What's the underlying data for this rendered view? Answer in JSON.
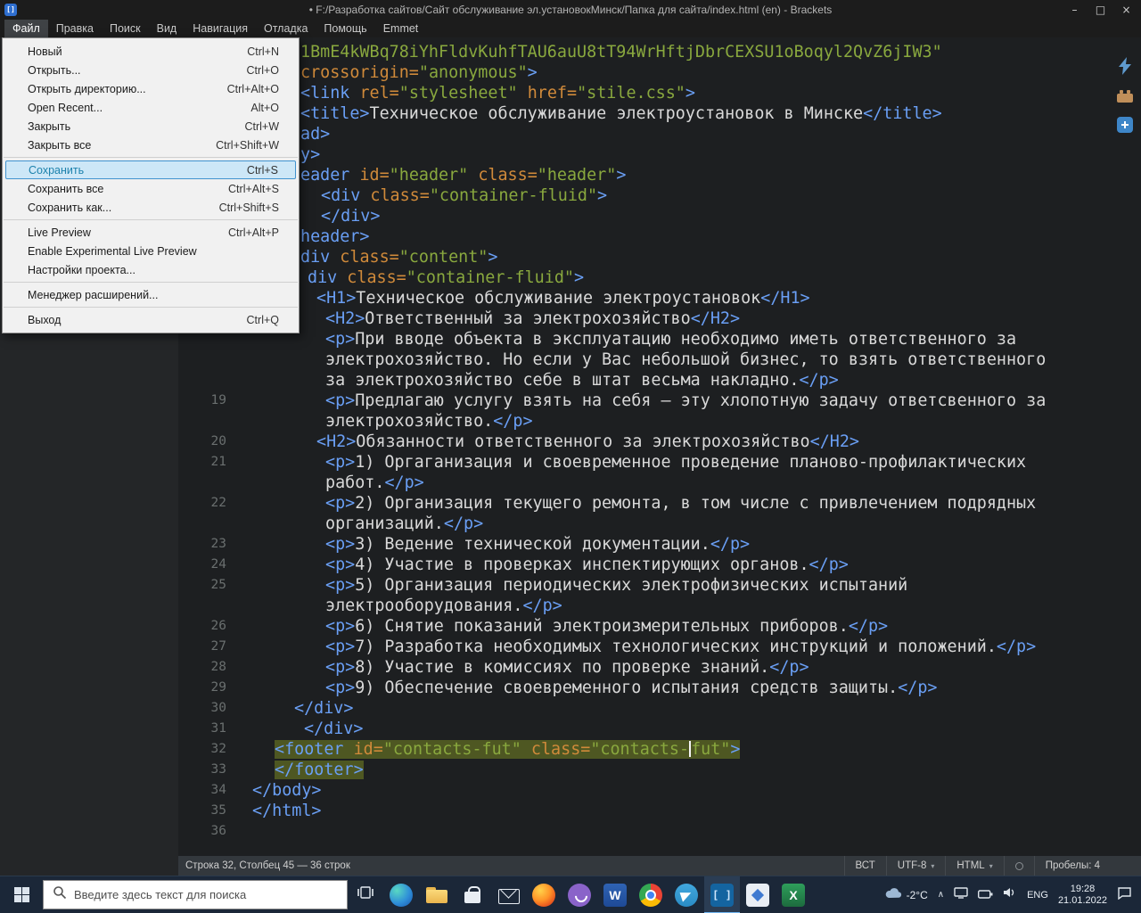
{
  "titlebar": {
    "title": "• F:/Разработка сайтов/Сайт обслуживание эл.установокМинск/Папка для сайта/index.html (en) - Brackets",
    "controls": {
      "minimize": "–",
      "maximize": "□",
      "close": "×"
    }
  },
  "menubar": {
    "active_id": "file",
    "items": [
      {
        "id": "file",
        "label": "Файл"
      },
      {
        "id": "edit",
        "label": "Правка"
      },
      {
        "id": "find",
        "label": "Поиск"
      },
      {
        "id": "view",
        "label": "Вид"
      },
      {
        "id": "navigate",
        "label": "Навигация"
      },
      {
        "id": "debug",
        "label": "Отладка"
      },
      {
        "id": "help",
        "label": "Помощь"
      },
      {
        "id": "emmet",
        "label": "Emmet"
      }
    ]
  },
  "file_menu": {
    "items": [
      {
        "id": "new",
        "label": "Новый",
        "shortcut": "Ctrl+N"
      },
      {
        "id": "open",
        "label": "Открыть...",
        "shortcut": "Ctrl+O"
      },
      {
        "id": "open-folder",
        "label": "Открыть директорию...",
        "shortcut": "Ctrl+Alt+O"
      },
      {
        "id": "open-recent",
        "label": "Open Recent...",
        "shortcut": "Alt+O"
      },
      {
        "id": "close",
        "label": "Закрыть",
        "shortcut": "Ctrl+W"
      },
      {
        "id": "close-all",
        "label": "Закрыть все",
        "shortcut": "Ctrl+Shift+W"
      },
      {
        "separator": true
      },
      {
        "id": "save",
        "label": "Сохранить",
        "shortcut": "Ctrl+S",
        "highlighted": true
      },
      {
        "id": "save-all",
        "label": "Сохранить все",
        "shortcut": "Ctrl+Alt+S"
      },
      {
        "id": "save-as",
        "label": "Сохранить как...",
        "shortcut": "Ctrl+Shift+S"
      },
      {
        "separator": true
      },
      {
        "id": "live-preview",
        "label": "Live Preview",
        "shortcut": "Ctrl+Alt+P"
      },
      {
        "id": "experimental-live-preview",
        "label": "Enable Experimental Live Preview",
        "shortcut": ""
      },
      {
        "id": "project-settings",
        "label": "Настройки проекта...",
        "shortcut": ""
      },
      {
        "separator": true
      },
      {
        "id": "extension-manager",
        "label": "Менеджер расширений...",
        "shortcut": ""
      },
      {
        "separator": true
      },
      {
        "id": "exit",
        "label": "Выход",
        "shortcut": "Ctrl+Q"
      }
    ]
  },
  "editor": {
    "rows": [
      {
        "n": "",
        "ind": 54,
        "segs": [
          [
            "s",
            "1BmE4kWBq78iYhFldvKuhfTAU6auU8tT94WrHftjDbrCEXSU1oBoqyl2QvZ6jIW3\""
          ]
        ]
      },
      {
        "n": "",
        "ind": 54,
        "segs": [
          [
            "a",
            "crossorigin="
          ],
          [
            "s",
            "\"anonymous\""
          ],
          [
            "t",
            ">"
          ]
        ]
      },
      {
        "n": "",
        "ind": 54,
        "segs": [
          [
            "t",
            "<link"
          ],
          [
            "w",
            " "
          ],
          [
            "a",
            "rel="
          ],
          [
            "s",
            "\"stylesheet\""
          ],
          [
            "w",
            " "
          ],
          [
            "a",
            "href="
          ],
          [
            "s",
            "\"stile.css\""
          ],
          [
            "t",
            ">"
          ]
        ]
      },
      {
        "n": "",
        "ind": 54,
        "segs": [
          [
            "t",
            "<title>"
          ],
          [
            "x",
            "Техническое обслуживание электроустановок в Минске"
          ],
          [
            "t",
            "</title>"
          ]
        ]
      },
      {
        "n": "",
        "ind": 54,
        "segs": [
          [
            "t",
            "ad>"
          ]
        ]
      },
      {
        "n": "",
        "ind": 54,
        "segs": [
          [
            "t",
            "y>"
          ]
        ]
      },
      {
        "n": "",
        "ind": 54,
        "segs": [
          [
            "t",
            "eader"
          ],
          [
            "w",
            " "
          ],
          [
            "a",
            "id="
          ],
          [
            "s",
            "\"header\""
          ],
          [
            "w",
            " "
          ],
          [
            "a",
            "class="
          ],
          [
            "s",
            "\"header\""
          ],
          [
            "t",
            ">"
          ]
        ]
      },
      {
        "n": "",
        "ind": 77,
        "segs": [
          [
            "t",
            "<div"
          ],
          [
            "w",
            " "
          ],
          [
            "a",
            "class="
          ],
          [
            "s",
            "\"container-fluid\""
          ],
          [
            "t",
            ">"
          ]
        ]
      },
      {
        "n": "",
        "ind": 77,
        "segs": [
          [
            "t",
            "</div>"
          ]
        ]
      },
      {
        "n": "",
        "ind": 54,
        "segs": [
          [
            "t",
            "header>"
          ]
        ]
      },
      {
        "n": "",
        "ind": 54,
        "segs": [
          [
            "t",
            "div"
          ],
          [
            "w",
            " "
          ],
          [
            "a",
            "class="
          ],
          [
            "s",
            "\"content\""
          ],
          [
            "t",
            ">"
          ]
        ]
      },
      {
        "n": "",
        "ind": 62,
        "segs": [
          [
            "t",
            "div"
          ],
          [
            "w",
            " "
          ],
          [
            "a",
            "class="
          ],
          [
            "s",
            "\"container-fluid\""
          ],
          [
            "t",
            ">"
          ]
        ]
      },
      {
        "n": "",
        "ind": 72,
        "segs": [
          [
            "t",
            "<H1>"
          ],
          [
            "x",
            "Техническое обслуживание электроустановок"
          ],
          [
            "t",
            "</H1>"
          ]
        ]
      },
      {
        "n": "",
        "ind": 82,
        "segs": [
          [
            "t",
            "<H2>"
          ],
          [
            "x",
            "Ответственный за электрохозяйство"
          ],
          [
            "t",
            "</H2>"
          ]
        ]
      },
      {
        "n": "",
        "ind": 82,
        "segs": [
          [
            "t",
            "<p>"
          ],
          [
            "x",
            "При вводе объекта в эксплуатацию необходимо иметь ответственного за"
          ]
        ]
      },
      {
        "n": "",
        "ind": 82,
        "segs": [
          [
            "x",
            "электрохозяйство. Но если у Вас небольшой бизнес, то взять ответственного"
          ]
        ]
      },
      {
        "n": "",
        "ind": 82,
        "segs": [
          [
            "x",
            "за электрохозяйство себе в штат весьма накладно."
          ],
          [
            "t",
            "</p>"
          ]
        ]
      },
      {
        "n": "19",
        "ind": 82,
        "segs": [
          [
            "t",
            "<p>"
          ],
          [
            "x",
            "Предлагаю услугу взять на себя — эту хлопотную задачу ответсвенного за"
          ]
        ]
      },
      {
        "n": "",
        "ind": 82,
        "segs": [
          [
            "x",
            "электрохозяйство."
          ],
          [
            "t",
            "</p>"
          ]
        ]
      },
      {
        "n": "20",
        "ind": 72,
        "segs": [
          [
            "t",
            "<H2>"
          ],
          [
            "x",
            "Обязанности ответственного за электрохозяйство"
          ],
          [
            "t",
            "</H2>"
          ]
        ]
      },
      {
        "n": "21",
        "ind": 82,
        "segs": [
          [
            "t",
            "<p>"
          ],
          [
            "x",
            "1) Оргаганизация и своевременное проведение планово-профилактических"
          ]
        ]
      },
      {
        "n": "",
        "ind": 82,
        "segs": [
          [
            "x",
            "работ."
          ],
          [
            "t",
            "</p>"
          ]
        ]
      },
      {
        "n": "22",
        "ind": 82,
        "segs": [
          [
            "t",
            "<p>"
          ],
          [
            "x",
            "2) Организация текущего ремонта, в том числе с привлечением подрядных"
          ]
        ]
      },
      {
        "n": "",
        "ind": 82,
        "segs": [
          [
            "x",
            "организаций."
          ],
          [
            "t",
            "</p>"
          ]
        ]
      },
      {
        "n": "23",
        "ind": 82,
        "segs": [
          [
            "t",
            "<p>"
          ],
          [
            "x",
            "3) Ведение технической документации."
          ],
          [
            "t",
            "</p>"
          ]
        ]
      },
      {
        "n": "24",
        "ind": 82,
        "segs": [
          [
            "t",
            "<p>"
          ],
          [
            "x",
            "4) Участие в проверках инспектирующих органов."
          ],
          [
            "t",
            "</p>"
          ]
        ]
      },
      {
        "n": "25",
        "ind": 82,
        "segs": [
          [
            "t",
            "<p>"
          ],
          [
            "x",
            "5) Организация периодических электрофизических испытаний"
          ]
        ]
      },
      {
        "n": "",
        "ind": 82,
        "segs": [
          [
            "x",
            "электрооборудования."
          ],
          [
            "t",
            "</p>"
          ]
        ]
      },
      {
        "n": "26",
        "ind": 82,
        "segs": [
          [
            "t",
            "<p>"
          ],
          [
            "x",
            "6) Снятие показаний электроизмерительных приборов."
          ],
          [
            "t",
            "</p>"
          ]
        ]
      },
      {
        "n": "27",
        "ind": 82,
        "segs": [
          [
            "t",
            "<p>"
          ],
          [
            "x",
            "7) Разработка необходимых технологических инструкций и положений."
          ],
          [
            "t",
            "</p>"
          ]
        ]
      },
      {
        "n": "28",
        "ind": 82,
        "segs": [
          [
            "t",
            "<p>"
          ],
          [
            "x",
            "8) Участие в комиссиях по проверке знаний."
          ],
          [
            "t",
            "</p>"
          ]
        ]
      },
      {
        "n": "29",
        "ind": 82,
        "segs": [
          [
            "t",
            "<p>"
          ],
          [
            "x",
            "9) Обеспечение своевременного испытания средств защиты."
          ],
          [
            "t",
            "</p>"
          ]
        ]
      },
      {
        "n": "30",
        "ind": 47,
        "segs": [
          [
            "t",
            "</div>"
          ]
        ]
      },
      {
        "n": "31",
        "ind": 58,
        "segs": [
          [
            "t",
            "</div>"
          ]
        ]
      },
      {
        "n": "32",
        "ind": 25,
        "hl": true,
        "segs": [
          [
            "t",
            "<footer"
          ],
          [
            "w",
            " "
          ],
          [
            "a",
            "id="
          ],
          [
            "s",
            "\"contacts-fut\""
          ],
          [
            "w",
            " "
          ],
          [
            "a",
            "class="
          ],
          [
            "s",
            "\"contacts-"
          ],
          [
            "cur",
            ""
          ],
          [
            "s",
            "fut\""
          ],
          [
            "t",
            ">"
          ]
        ]
      },
      {
        "n": "33",
        "ind": 25,
        "hl": true,
        "segs": [
          [
            "t",
            "</footer>"
          ]
        ]
      },
      {
        "n": "34",
        "ind": 0,
        "segs": [
          [
            "t",
            "</body>"
          ]
        ]
      },
      {
        "n": "35",
        "ind": 0,
        "segs": [
          [
            "t",
            "</html>"
          ]
        ]
      },
      {
        "n": "36",
        "ind": 0,
        "segs": []
      }
    ]
  },
  "right_toolbar": {
    "icons": [
      "live-preview-lightning",
      "extension-manager-brick",
      "extension-plugin"
    ]
  },
  "statusbar": {
    "cursor_info": "Строка 32, Столбец 45 — 36 строк",
    "overwrite": "ВСТ",
    "encoding": "UTF-8",
    "language": "HTML",
    "spaces": "Пробелы: 4"
  },
  "taskbar": {
    "search_placeholder": "Введите здесь текст для поиска",
    "apps": [
      {
        "id": "edge"
      },
      {
        "id": "explorer"
      },
      {
        "id": "store"
      },
      {
        "id": "mail"
      },
      {
        "id": "firefox"
      },
      {
        "id": "viber"
      },
      {
        "id": "word"
      },
      {
        "id": "chrome"
      },
      {
        "id": "telegram"
      },
      {
        "id": "brackets",
        "active": true
      },
      {
        "id": "photos"
      },
      {
        "id": "excel"
      }
    ],
    "tray": {
      "temperature": "-2°C",
      "language": "ENG",
      "time": "19:28",
      "date": "21.01.2022"
    }
  }
}
